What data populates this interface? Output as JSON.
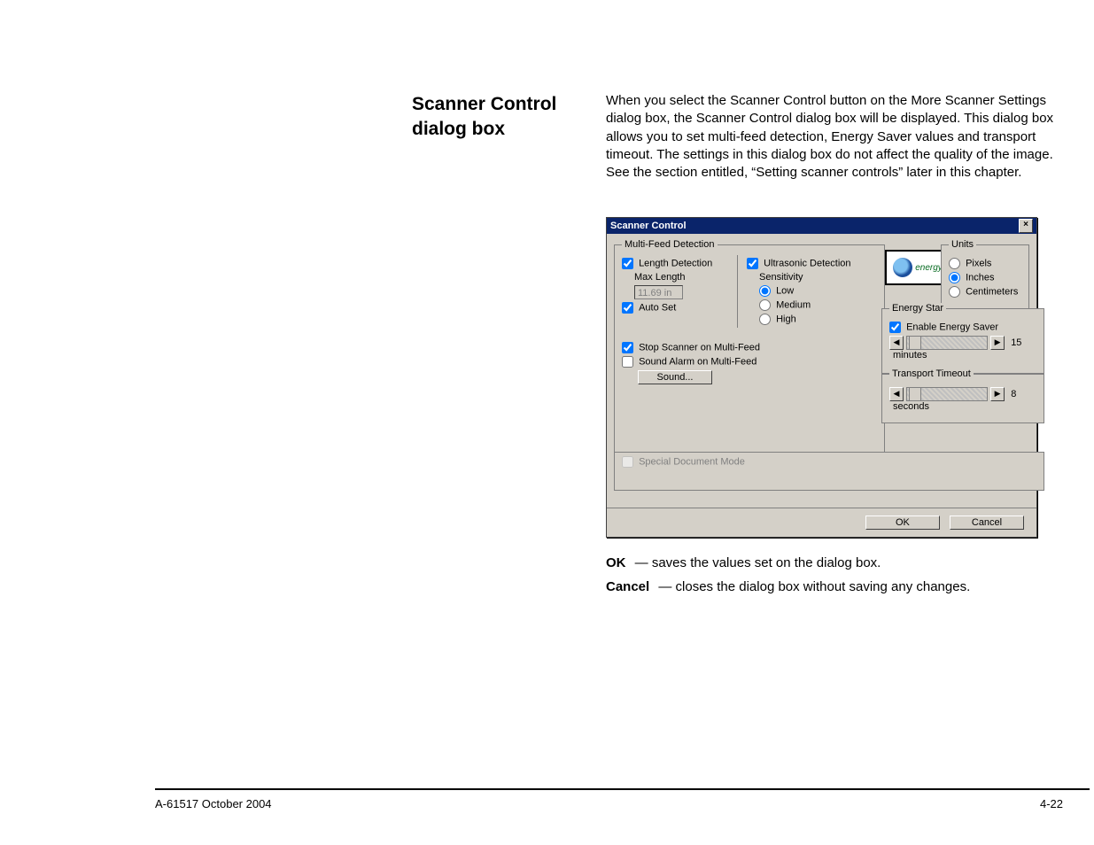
{
  "sideHeading": "Scanner Control dialog box",
  "bodyPara": "When you select the Scanner Control button on the More Scanner Settings dialog box, the Scanner Control dialog box will be displayed. This dialog box allows you to set multi-feed detection, Energy Saver values and transport timeout. The settings in this dialog box do not affect the quality of the image. See the section entitled, “Setting scanner controls” later in this chapter.",
  "defs": {
    "okTerm": "OK",
    "okDesc": "— saves the values set on the dialog box.",
    "cancelTerm": "Cancel",
    "cancelDesc": "— closes the dialog box without saving any changes."
  },
  "footer": {
    "left": "A-61517 October 2004",
    "right": "4-22"
  },
  "dlg": {
    "title": "Scanner Control",
    "close": "×",
    "mfd": {
      "legend": "Multi-Feed Detection",
      "lengthDetection": "Length Detection",
      "maxLengthLabel": "Max Length",
      "maxLengthValue": "11.69 in",
      "autoSet": "Auto Set",
      "ultrasonic": "Ultrasonic Detection",
      "sensitivity": "Sensitivity",
      "low": "Low",
      "medium": "Medium",
      "high": "High",
      "stopScanner": "Stop Scanner on Multi-Feed",
      "soundAlarm": "Sound Alarm on Multi-Feed",
      "soundBtn": "Sound..."
    },
    "units": {
      "legend": "Units",
      "pixels": "Pixels",
      "inches": "Inches",
      "centimeters": "Centimeters"
    },
    "energyStar": {
      "legend": "Energy Star",
      "enable": "Enable Energy Saver",
      "value": "15",
      "unit": "minutes"
    },
    "transport": {
      "legend": "Transport Timeout",
      "value": "8",
      "unit": "seconds"
    },
    "special": "Special Document Mode",
    "ok": "OK",
    "cancel": "Cancel",
    "logoText": "energy"
  }
}
